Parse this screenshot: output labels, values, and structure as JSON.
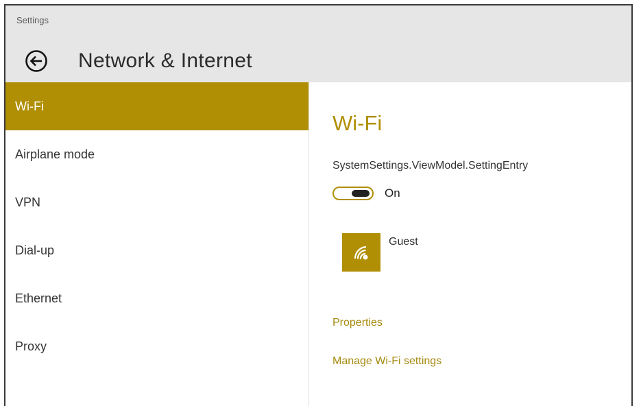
{
  "window": {
    "app_title": "Settings",
    "page_title": "Network & Internet"
  },
  "sidebar": {
    "items": [
      {
        "label": "Wi-Fi",
        "active": true
      },
      {
        "label": "Airplane mode",
        "active": false
      },
      {
        "label": "VPN",
        "active": false
      },
      {
        "label": "Dial-up",
        "active": false
      },
      {
        "label": "Ethernet",
        "active": false
      },
      {
        "label": "Proxy",
        "active": false
      }
    ]
  },
  "content": {
    "section_title": "Wi-Fi",
    "setting_entry": "SystemSettings.ViewModel.SettingEntry",
    "toggle": {
      "state_label": "On",
      "on": true
    },
    "network": {
      "name": "Guest",
      "icon": "wifi-icon"
    },
    "links": {
      "properties": "Properties",
      "manage": "Manage Wi-Fi settings"
    }
  },
  "colors": {
    "accent": "#b08f04",
    "titlebar": "#e6e6e6"
  },
  "icons": {
    "back": "back-arrow-icon",
    "network": "wifi-icon"
  }
}
